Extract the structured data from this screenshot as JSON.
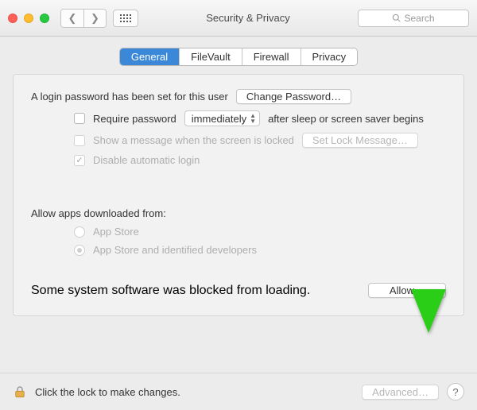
{
  "window": {
    "title": "Security & Privacy"
  },
  "search": {
    "placeholder": "Search"
  },
  "tabs": [
    {
      "label": "General",
      "active": true
    },
    {
      "label": "FileVault"
    },
    {
      "label": "Firewall"
    },
    {
      "label": "Privacy"
    }
  ],
  "login": {
    "text": "A login password has been set for this user",
    "change_btn": "Change Password…",
    "require": {
      "label_before": "Require password",
      "interval": "immediately",
      "label_after": "after sleep or screen saver begins",
      "checked": false
    },
    "message": {
      "label": "Show a message when the screen is locked",
      "set_btn": "Set Lock Message…",
      "checked": false
    },
    "disable_auto": {
      "label": "Disable automatic login",
      "checked": true
    }
  },
  "allow_apps": {
    "heading": "Allow apps downloaded from:",
    "options": [
      {
        "label": "App Store",
        "selected": false
      },
      {
        "label": "App Store and identified developers",
        "selected": true
      }
    ]
  },
  "blocked": {
    "text": "Some system software was blocked from loading.",
    "allow_btn": "Allow…"
  },
  "footer": {
    "lock_text": "Click the lock to make changes.",
    "advanced_btn": "Advanced…"
  },
  "colors": {
    "arrow": "#2bce17"
  }
}
